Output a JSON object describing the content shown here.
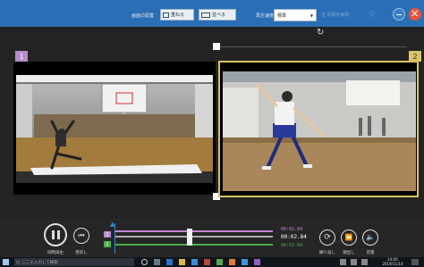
{
  "colors": {
    "toolbar_bg": "#2a6fb5",
    "badge1": "#b68ccd",
    "badge2": "#d9c26b",
    "track1": "#c784d6",
    "track2": "#4bb04b",
    "playhead": "#2a8bd8",
    "close_button": "#e5533c"
  },
  "toolbar": {
    "label1": "画面の配置",
    "btn1_label": "重ねる",
    "btn2_label": "並べる",
    "label2": "再生速度",
    "mode_value": "標準",
    "faded_label": "同期を解除"
  },
  "videos": {
    "v1_number": "1",
    "v2_number": "2"
  },
  "controls": {
    "play_pause_label": "同時再生",
    "skip_back_label": "巻戻し",
    "track1_marker": "1",
    "track2_marker": "2",
    "time1": "00:02.84",
    "time_main": "00:02.84",
    "time2": "00:02.84",
    "repeat_label": "繰り返し",
    "restart_label": "頭出し",
    "volume_label": "音量"
  },
  "icons": {
    "rotate": "rotate-icon",
    "minimize": "minimize-icon",
    "close": "close-icon",
    "pause": "pause-icon",
    "skip_back": "skip-back-icon",
    "repeat": "repeat-icon",
    "restart": "restart-icon",
    "volume": "volume-icon",
    "windows": "windows-icon",
    "search": "search-icon"
  },
  "taskbar": {
    "search_placeholder": "ここに入力して検索",
    "clock_time": "14:00",
    "clock_date": "2019/11/14"
  }
}
